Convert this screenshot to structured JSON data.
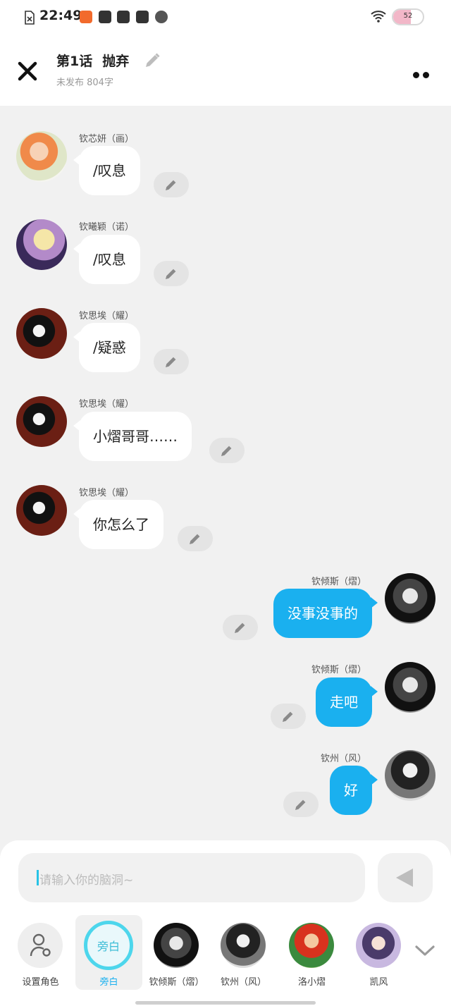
{
  "status": {
    "time": "22:49",
    "battery": "52"
  },
  "header": {
    "title": "第1话",
    "subtitle_title": "抛弃",
    "meta": "未发布 804字"
  },
  "messages": [
    {
      "name": "钦芯妍（画）",
      "text": "/叹息"
    },
    {
      "name": "钦曦颖（诺）",
      "text": "/叹息"
    },
    {
      "name": "钦思埃（耀）",
      "text": "/疑惑"
    },
    {
      "name": "钦思埃（耀）",
      "text": "小熠哥哥……"
    },
    {
      "name": "钦思埃（耀）",
      "text": "你怎么了"
    },
    {
      "name": "钦倾斯（熠）",
      "text": "没事没事的"
    },
    {
      "name": "钦倾斯（熠）",
      "text": "走吧"
    },
    {
      "name": "钦州（风）",
      "text": "好"
    }
  ],
  "input": {
    "placeholder": "请输入你的脑洞~"
  },
  "roles": [
    {
      "label": "设置角色"
    },
    {
      "label": "旁白",
      "badge": "旁白"
    },
    {
      "label": "钦倾斯（熠）"
    },
    {
      "label": "钦州（风）"
    },
    {
      "label": "洛小熠"
    },
    {
      "label": "凯风"
    }
  ],
  "colors": {
    "accent": "#1ab0ef",
    "narration_ring": "#4dd6ec",
    "background": "#f1f1f1"
  }
}
